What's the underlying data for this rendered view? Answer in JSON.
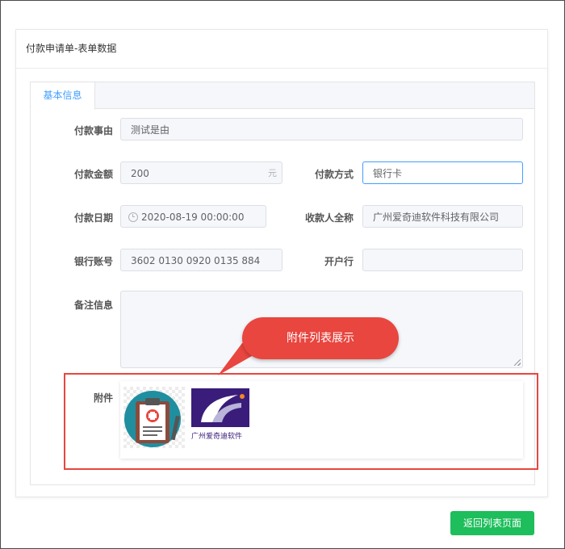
{
  "card": {
    "title": "付款申请单-表单数据"
  },
  "tabs": [
    {
      "label": "基本信息"
    }
  ],
  "form": {
    "reason": {
      "label": "付款事由",
      "value": "测试是由"
    },
    "amount": {
      "label": "付款金额",
      "value": "200",
      "unit": "元"
    },
    "method": {
      "label": "付款方式",
      "value": "银行卡"
    },
    "date": {
      "label": "付款日期",
      "value": "2020-08-19 00:00:00"
    },
    "payee": {
      "label": "收款人全称",
      "value": "广州爱奇迪软件科技有限公司"
    },
    "account": {
      "label": "银行账号",
      "value": "3602 0130 0920 0135 884"
    },
    "bank": {
      "label": "开户行",
      "value": ""
    },
    "remark": {
      "label": "备注信息",
      "value": ""
    },
    "attachments": {
      "label": "附件",
      "items": [
        {
          "icon": "clipboard-medical-icon"
        },
        {
          "icon": "company-logo-image",
          "caption": "广州爱奇迪软件"
        }
      ]
    }
  },
  "annotation": {
    "text": "附件列表展示",
    "color": "#e8463f"
  },
  "footer": {
    "back_label": "返回列表页面",
    "color": "#1dbe5b"
  }
}
